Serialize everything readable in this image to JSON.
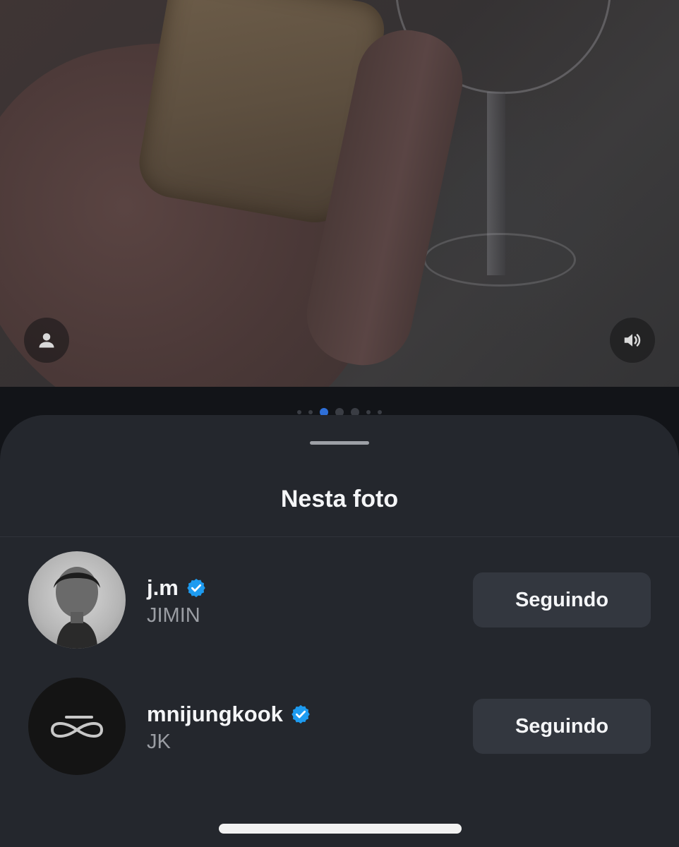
{
  "sheet": {
    "title": "Nesta foto",
    "people": [
      {
        "username": "j.m",
        "name": "JIMIN",
        "verified": true,
        "button_label": "Seguindo",
        "avatar": "portrait-photo"
      },
      {
        "username": "mnijungkook",
        "name": "JK",
        "verified": true,
        "button_label": "Seguindo",
        "avatar": "infinity-logo"
      }
    ]
  },
  "photo": {
    "tagged_users_icon": "person-icon",
    "sound_icon": "speaker-icon"
  },
  "carousel": {
    "active_index": 2
  },
  "colors": {
    "verified": "#1d9bf0",
    "sheet_bg": "#24272d",
    "button_bg": "#33373f",
    "active_dot": "#2e6fd8"
  }
}
